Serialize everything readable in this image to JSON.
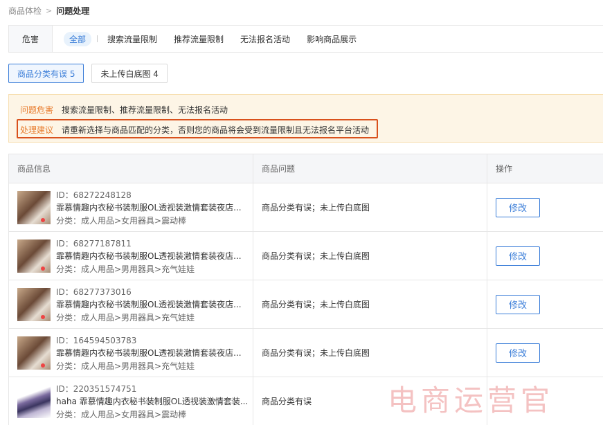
{
  "breadcrumb": {
    "parent": "商品体检",
    "separator": ">",
    "current": "问题处理"
  },
  "filter": {
    "label": "危害",
    "tabs": [
      {
        "label": "全部",
        "active": true
      },
      {
        "label": "搜索流量限制",
        "active": false
      },
      {
        "label": "推荐流量限制",
        "active": false
      },
      {
        "label": "无法报名活动",
        "active": false
      },
      {
        "label": "影响商品展示",
        "active": false
      }
    ]
  },
  "subtabs": [
    {
      "label": "商品分类有误 5",
      "active": true
    },
    {
      "label": "未上传白底图 4",
      "active": false
    }
  ],
  "notice": {
    "harm_key": "问题危害",
    "harm_value": "搜索流量限制、推荐流量限制、无法报名活动",
    "advice_key": "处理建议",
    "advice_value": "请重新选择与商品匹配的分类，否则您的商品将会受到流量限制且无法报名平台活动"
  },
  "table": {
    "headers": {
      "info": "商品信息",
      "problem": "商品问题",
      "action": "操作"
    },
    "rows": [
      {
        "id": "ID：68272248128",
        "title": "霏慕情趣内衣秘书装制服OL透视装激情套装夜店...",
        "category": "分类：成人用品>女用器具>震动棒",
        "problem": "商品分类有误；未上传白底图",
        "action": "修改",
        "thumb": "lingerie-photo"
      },
      {
        "id": "ID：68277187811",
        "title": "霏慕情趣内衣秘书装制服OL透视装激情套装夜店...",
        "category": "分类：成人用品>男用器具>充气娃娃",
        "problem": "商品分类有误；未上传白底图",
        "action": "修改",
        "thumb": "lingerie-photo"
      },
      {
        "id": "ID：68277373016",
        "title": "霏慕情趣内衣秘书装制服OL透视装激情套装夜店...",
        "category": "分类：成人用品>男用器具>充气娃娃",
        "problem": "商品分类有误；未上传白底图",
        "action": "修改",
        "thumb": "lingerie-photo"
      },
      {
        "id": "ID：164594503783",
        "title": "霏慕情趣内衣秘书装制服OL透视装激情套装夜店...",
        "category": "分类：成人用品>男用器具>充气娃娃",
        "problem": "商品分类有误；未上传白底图",
        "action": "修改",
        "thumb": "lingerie-photo"
      },
      {
        "id": "ID：220351574751",
        "title": "haha 霏慕情趣内衣秘书装制服OL透视装激情套装...",
        "category": "分类：成人用品>女用器具>震动棒",
        "problem": "商品分类有误",
        "action": "",
        "thumb": "shoe-photo"
      }
    ]
  },
  "watermark": "电商运营官",
  "colors": {
    "accent": "#3a7dd8",
    "warning": "#e87b2c",
    "highlight_border": "#d9511c",
    "notice_bg": "#fdf5e6"
  }
}
